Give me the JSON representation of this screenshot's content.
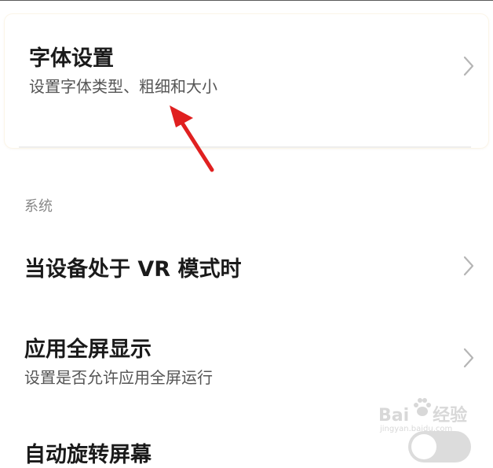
{
  "font_settings": {
    "title": "字体设置",
    "subtitle": "设置字体类型、粗细和大小"
  },
  "system_section": {
    "label": "系统",
    "items": [
      {
        "title": "当设备处于 VR 模式时"
      },
      {
        "title": "应用全屏显示",
        "subtitle": "设置是否允许应用全屏运行"
      },
      {
        "title": "自动旋转屏幕"
      }
    ]
  },
  "auto_rotate_toggle": {
    "on": false
  },
  "watermark": {
    "main": "Bai",
    "brand": "经验",
    "sub": "jingyan.baidu.com"
  },
  "colors": {
    "arrow": "#e02020",
    "accent_bg": "#fbf5e8"
  },
  "icons": [
    "chevron-right-icon",
    "red-annotation-arrow-icon",
    "baidu-paw-icon"
  ]
}
